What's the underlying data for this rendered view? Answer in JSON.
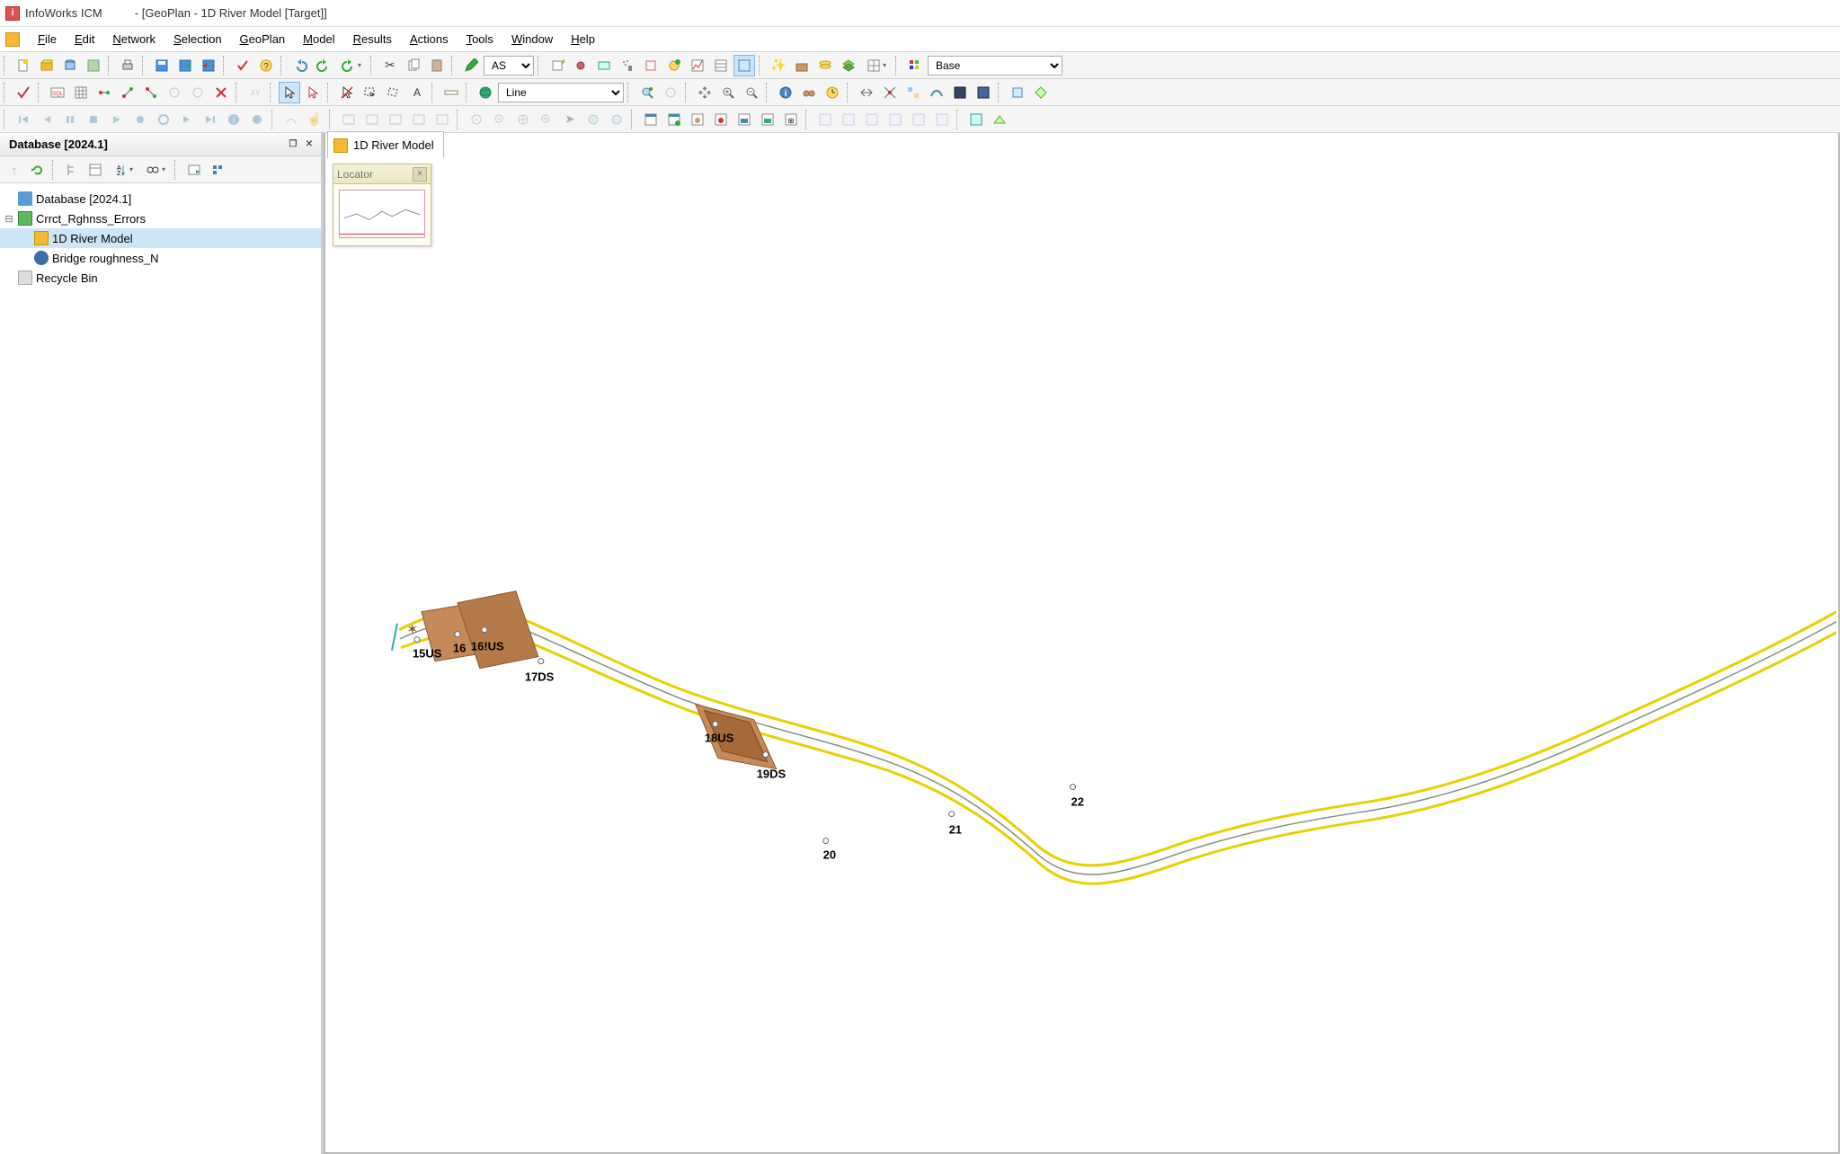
{
  "app": {
    "name": "InfoWorks ICM",
    "doc_title": "- [GeoPlan - 1D River Model [Target]]"
  },
  "menu": [
    "File",
    "Edit",
    "Network",
    "Selection",
    "GeoPlan",
    "Model",
    "Results",
    "Actions",
    "Tools",
    "Window",
    "Help"
  ],
  "toolbar": {
    "as_dropdown": "AS",
    "line_dropdown": "Line",
    "base_dropdown": "Base"
  },
  "db_panel": {
    "title": "Database [2024.1]",
    "tree": {
      "root": "Database [2024.1]",
      "group": "Crrct_Rghnss_Errors",
      "network": "1D River Model",
      "rain": "Bridge roughness_N",
      "bin": "Recycle Bin"
    }
  },
  "geoplan": {
    "tab": "1D River Model",
    "locator_title": "Locator",
    "node_labels": [
      "15US",
      "16",
      "16!US",
      "17DS",
      "18US",
      "19DS",
      "20",
      "21",
      "22"
    ]
  }
}
